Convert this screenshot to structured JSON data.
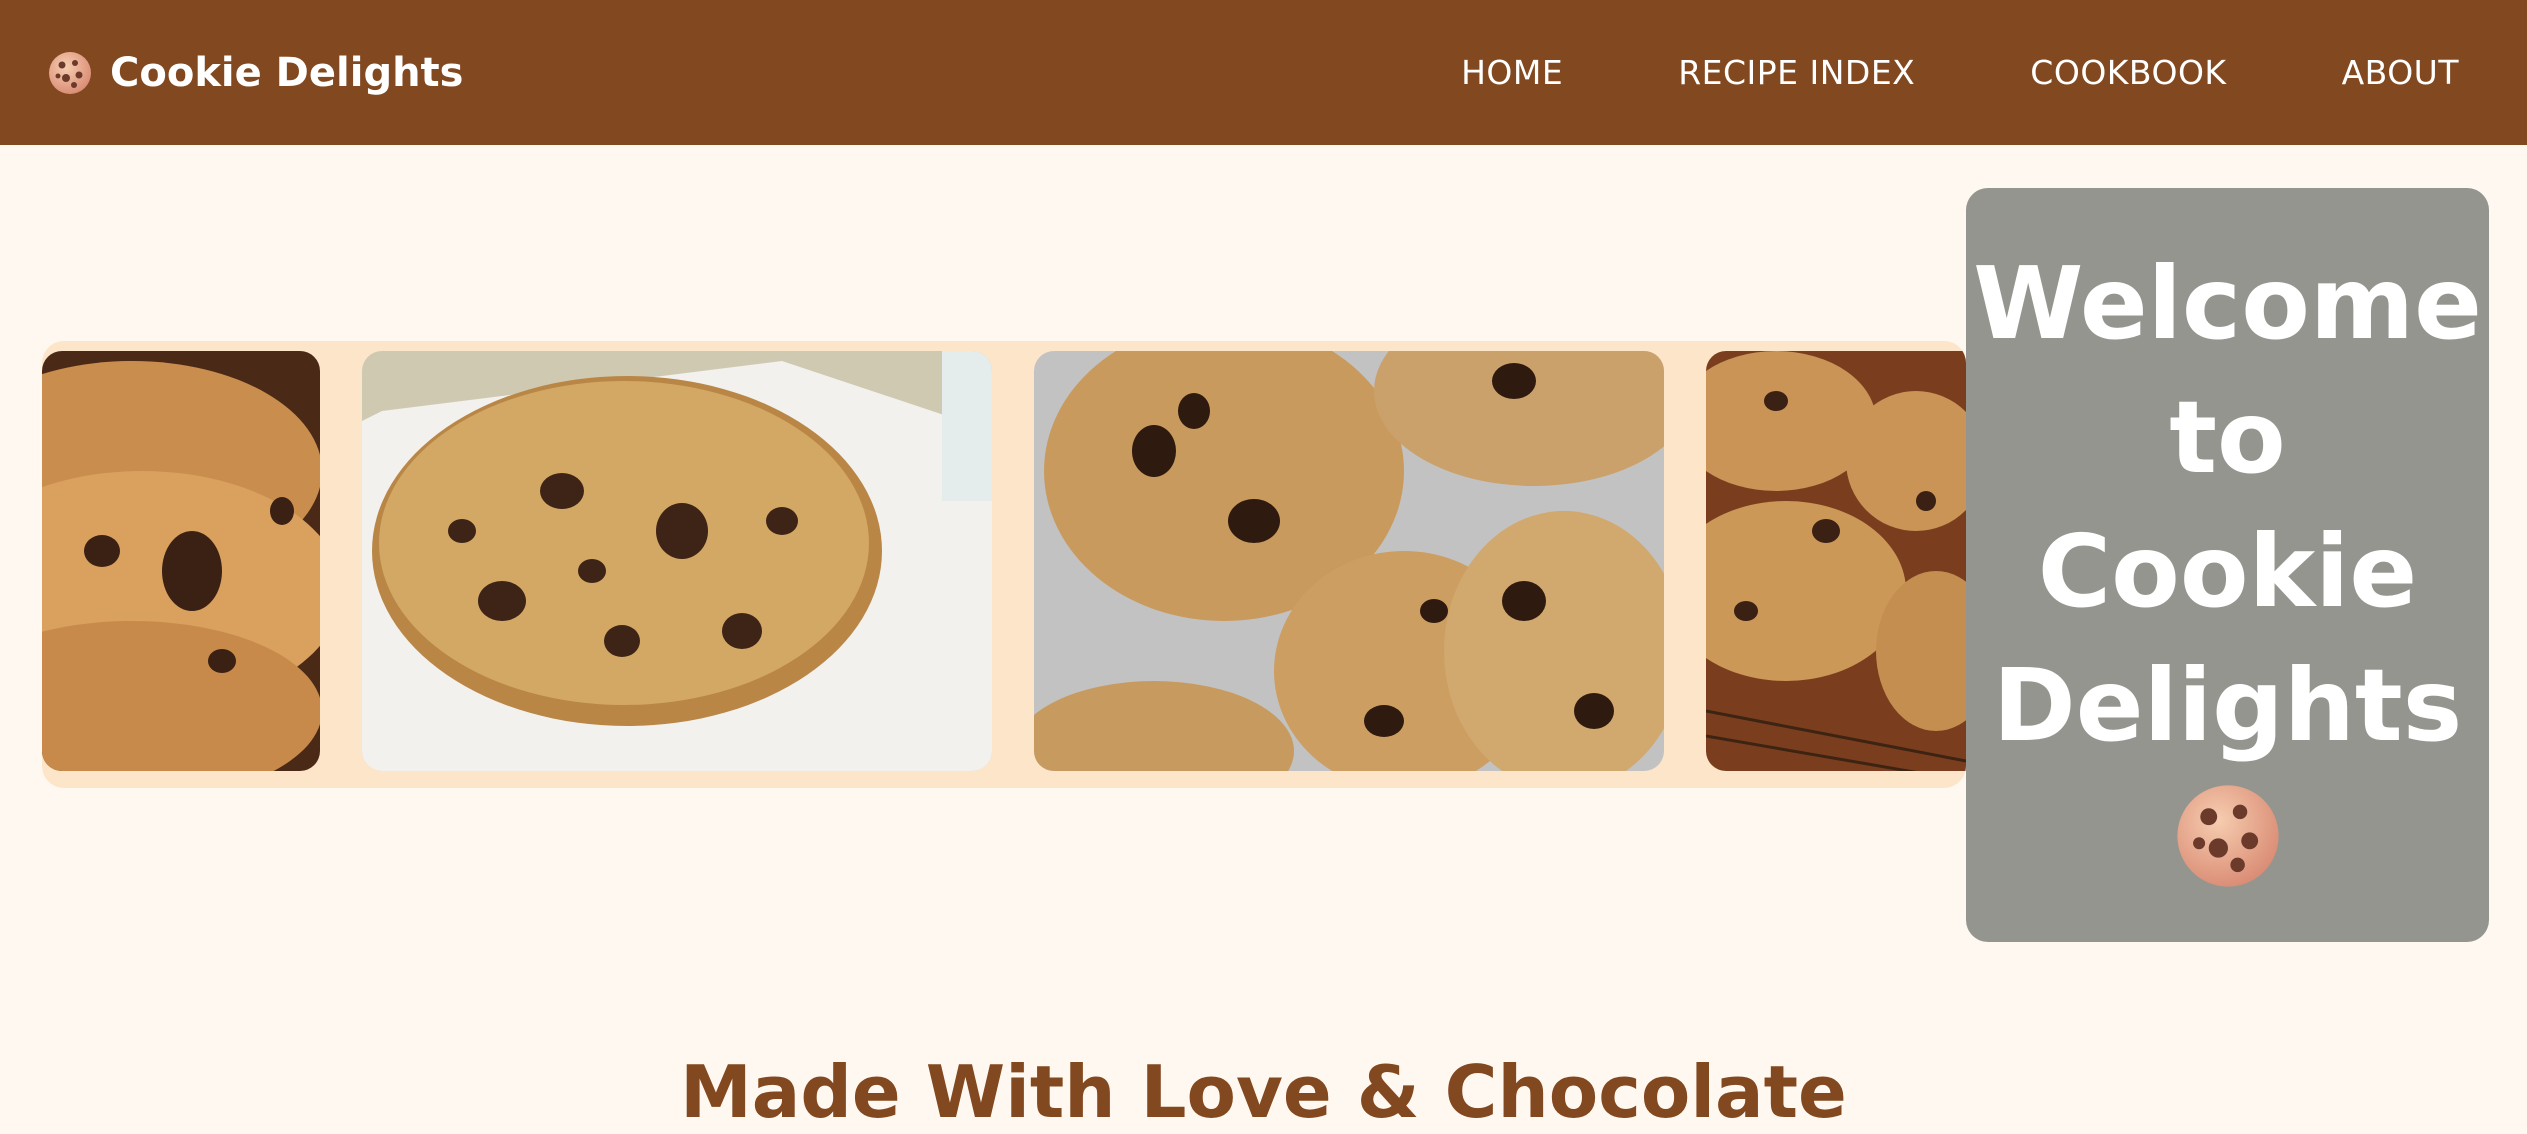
{
  "brand": {
    "name": "Cookie Delights",
    "icon": "cookie-icon"
  },
  "nav": {
    "items": [
      {
        "label": "HOME"
      },
      {
        "label": "RECIPE INDEX"
      },
      {
        "label": "COOKBOOK"
      },
      {
        "label": "ABOUT"
      }
    ]
  },
  "carousel": {
    "slides": [
      {
        "alt": "stacked-cookies-photo"
      },
      {
        "alt": "single-cookie-on-parchment-photo"
      },
      {
        "alt": "cookies-on-tray-photo"
      },
      {
        "alt": "cookies-on-cooling-rack-photo"
      }
    ]
  },
  "welcome": {
    "title": "Welcome to Cookie Delights",
    "icon": "cookie-icon"
  },
  "section": {
    "title": "Made With Love & Chocolate"
  },
  "colors": {
    "header": "#82481f",
    "page_background": "#fff8f0",
    "carousel_background": "#fde5c9",
    "welcome_background": "#959590",
    "text_light": "#ffffff"
  }
}
